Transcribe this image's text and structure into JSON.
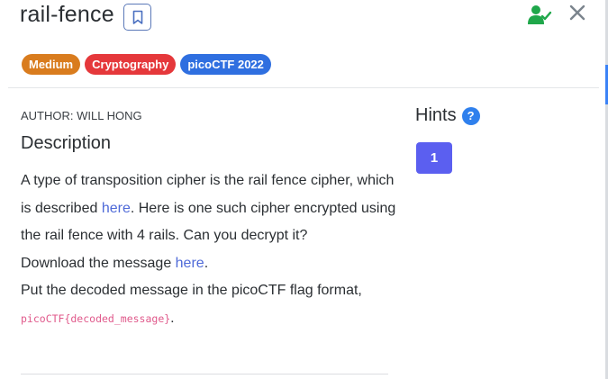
{
  "challenge": {
    "title": "rail-fence",
    "tags": [
      {
        "label": "Medium",
        "color": "#d97c1e"
      },
      {
        "label": "Cryptography",
        "color": "#e5383b"
      },
      {
        "label": "picoCTF 2022",
        "color": "#2f6fe0"
      }
    ]
  },
  "header": {
    "bookmark_icon": "bookmark-icon",
    "solved_icon": "user-check-icon",
    "close_icon": "close-icon",
    "solved_color": "#1fa74a",
    "close_color": "#7b848d"
  },
  "author": "AUTHOR: WILL HONG",
  "description": {
    "heading": "Description",
    "line1": "A type of transposition cipher is the rail fence cipher, which is described ",
    "link1": "here",
    "line1_end": ". Here is one such cipher encrypted using the rail fence with 4 rails. Can you decrypt it?",
    "line2": "Download the message ",
    "link2": "here",
    "line2_end": ".",
    "line3": "Put the decoded message in the picoCTF flag format, ",
    "code": "picoCTF{decoded_message}",
    "line3_end": "."
  },
  "hints": {
    "title": "Hints",
    "help_icon": "?",
    "buttons": [
      "1"
    ]
  }
}
